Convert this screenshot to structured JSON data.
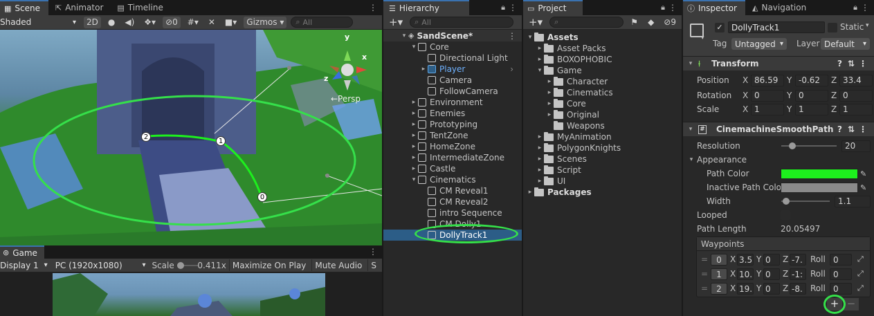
{
  "scene": {
    "tabs": [
      "Scene",
      "Animator",
      "Timeline"
    ],
    "shading_mode": "Shaded",
    "mode_2d": "2D",
    "hidden_count": "0",
    "gizmos_label": "Gizmos",
    "search_placeholder": "All",
    "persp_label": "←Persp",
    "gizmo_axes": {
      "y": "y",
      "x": "x",
      "z": "z"
    },
    "waypoint_labels": [
      "2",
      "1",
      "0"
    ]
  },
  "game": {
    "tab": "Game",
    "display": "Display 1",
    "resolution": "PC (1920x1080)",
    "scale_label": "Scale",
    "scale_value": "0.411x",
    "maximize": "Maximize On Play",
    "mute": "Mute Audio",
    "stats_cut": "S"
  },
  "hierarchy": {
    "tab": "Hierarchy",
    "search_placeholder": "All",
    "scene_name": "SandScene*",
    "items": [
      {
        "label": "Core",
        "depth": 1,
        "arrow": "▾",
        "icon": "cube"
      },
      {
        "label": "Directional Light",
        "depth": 2,
        "arrow": "",
        "icon": "cube"
      },
      {
        "label": "Player",
        "depth": 2,
        "arrow": "▸",
        "icon": "cube-blue",
        "blue": true
      },
      {
        "label": "Camera",
        "depth": 2,
        "arrow": "",
        "icon": "cube"
      },
      {
        "label": "FollowCamera",
        "depth": 2,
        "arrow": "",
        "icon": "cube"
      },
      {
        "label": "Environment",
        "depth": 1,
        "arrow": "▸",
        "icon": "cube"
      },
      {
        "label": "Enemies",
        "depth": 1,
        "arrow": "▸",
        "icon": "cube"
      },
      {
        "label": "Prototyping",
        "depth": 1,
        "arrow": "▸",
        "icon": "cube"
      },
      {
        "label": "TentZone",
        "depth": 1,
        "arrow": "▸",
        "icon": "cube"
      },
      {
        "label": "HomeZone",
        "depth": 1,
        "arrow": "▸",
        "icon": "cube"
      },
      {
        "label": "IntermediateZone",
        "depth": 1,
        "arrow": "▸",
        "icon": "cube"
      },
      {
        "label": "Castle",
        "depth": 1,
        "arrow": "▸",
        "icon": "cube"
      },
      {
        "label": "Cinematics",
        "depth": 1,
        "arrow": "▾",
        "icon": "cube"
      },
      {
        "label": "CM Reveal1",
        "depth": 2,
        "arrow": "",
        "icon": "cube"
      },
      {
        "label": "CM Reveal2",
        "depth": 2,
        "arrow": "",
        "icon": "cube"
      },
      {
        "label": "intro Sequence",
        "depth": 2,
        "arrow": "",
        "icon": "cube"
      },
      {
        "label": "CM Dolly1",
        "depth": 2,
        "arrow": "",
        "icon": "cube"
      },
      {
        "label": "DollyTrack1",
        "depth": 2,
        "arrow": "",
        "icon": "cube",
        "selected": true
      }
    ]
  },
  "project": {
    "tab": "Project",
    "hidden_count": "9",
    "items": [
      {
        "label": "Assets",
        "depth": 0,
        "arrow": "▾",
        "bold": true
      },
      {
        "label": "Asset Packs",
        "depth": 1,
        "arrow": "▸"
      },
      {
        "label": "BOXOPHOBIC",
        "depth": 1,
        "arrow": "▸"
      },
      {
        "label": "Game",
        "depth": 1,
        "arrow": "▾"
      },
      {
        "label": "Character",
        "depth": 2,
        "arrow": "▸"
      },
      {
        "label": "Cinematics",
        "depth": 2,
        "arrow": "▸"
      },
      {
        "label": "Core",
        "depth": 2,
        "arrow": "▸"
      },
      {
        "label": "Original",
        "depth": 2,
        "arrow": "▸"
      },
      {
        "label": "Weapons",
        "depth": 2,
        "arrow": ""
      },
      {
        "label": "MyAnimation",
        "depth": 1,
        "arrow": "▸"
      },
      {
        "label": "PolygonKnights",
        "depth": 1,
        "arrow": "▸"
      },
      {
        "label": "Scenes",
        "depth": 1,
        "arrow": "▸"
      },
      {
        "label": "Script",
        "depth": 1,
        "arrow": "▸"
      },
      {
        "label": "UI",
        "depth": 1,
        "arrow": "▸"
      },
      {
        "label": "Packages",
        "depth": 0,
        "arrow": "▸",
        "bold": true
      }
    ]
  },
  "inspector": {
    "tabs": [
      "Inspector",
      "Navigation"
    ],
    "object_name": "DollyTrack1",
    "static_label": "Static",
    "tag_label": "Tag",
    "tag_value": "Untagged",
    "layer_label": "Layer",
    "layer_value": "Default",
    "transform": {
      "title": "Transform",
      "position_label": "Position",
      "rotation_label": "Rotation",
      "scale_label": "Scale",
      "position": {
        "x": "86.59",
        "y": "-0.62",
        "z": "33.4"
      },
      "rotation": {
        "x": "0",
        "y": "0",
        "z": "0"
      },
      "scale": {
        "x": "1",
        "y": "1",
        "z": "1"
      }
    },
    "path": {
      "title": "CinemachineSmoothPath",
      "resolution_label": "Resolution",
      "resolution_value": "20",
      "resolution_fraction": 0.2,
      "appearance_label": "Appearance",
      "path_color_label": "Path Color",
      "path_color": "#1df01d",
      "inactive_color_label": "Inactive Path Colo",
      "inactive_color": "#8a8a8a",
      "width_label": "Width",
      "width_value": "1.1",
      "width_fraction": 0.1,
      "looped_label": "Looped",
      "path_length_label": "Path Length",
      "path_length_value": "20.05497",
      "waypoints_label": "Waypoints",
      "waypoints": [
        {
          "index": "0",
          "x": "3.5",
          "y": "0",
          "z": "-7.",
          "roll": "0"
        },
        {
          "index": "1",
          "x": "10.",
          "y": "0",
          "z": "-1:",
          "roll": "0"
        },
        {
          "index": "2",
          "x": "19.",
          "y": "0",
          "z": "-8.",
          "roll": "0"
        }
      ],
      "axis": {
        "x": "X",
        "y": "Y",
        "z": "Z",
        "roll": "Roll"
      },
      "add_label": "+",
      "remove_label": "−"
    }
  },
  "colors": {
    "highlight_ring": "#35e04a",
    "selection": "#2c5d87",
    "tab_accent": "#3a72b0"
  }
}
